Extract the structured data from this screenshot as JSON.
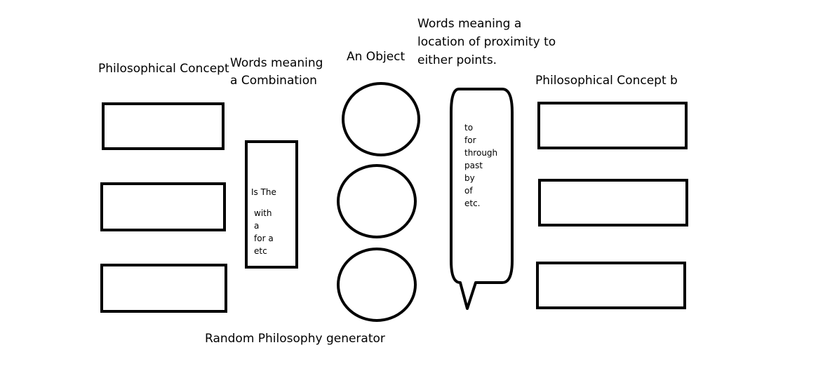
{
  "labels": {
    "concept_a": "Philosophical Concept",
    "combination_line1": "Words meaning",
    "combination_line2": "a Combination",
    "object": "An Object",
    "location_line1": "Words meaning a",
    "location_line2": "location of proximity to",
    "location_line3": "either points.",
    "concept_b": "Philosophical Concept b",
    "footer": "Random Philosophy generator"
  },
  "combination_words": {
    "first": "Is The",
    "rest": [
      "with",
      "a",
      "for a",
      "etc"
    ]
  },
  "proximity_words": [
    "to",
    "for",
    "through",
    "past",
    "by",
    "of",
    "etc."
  ]
}
